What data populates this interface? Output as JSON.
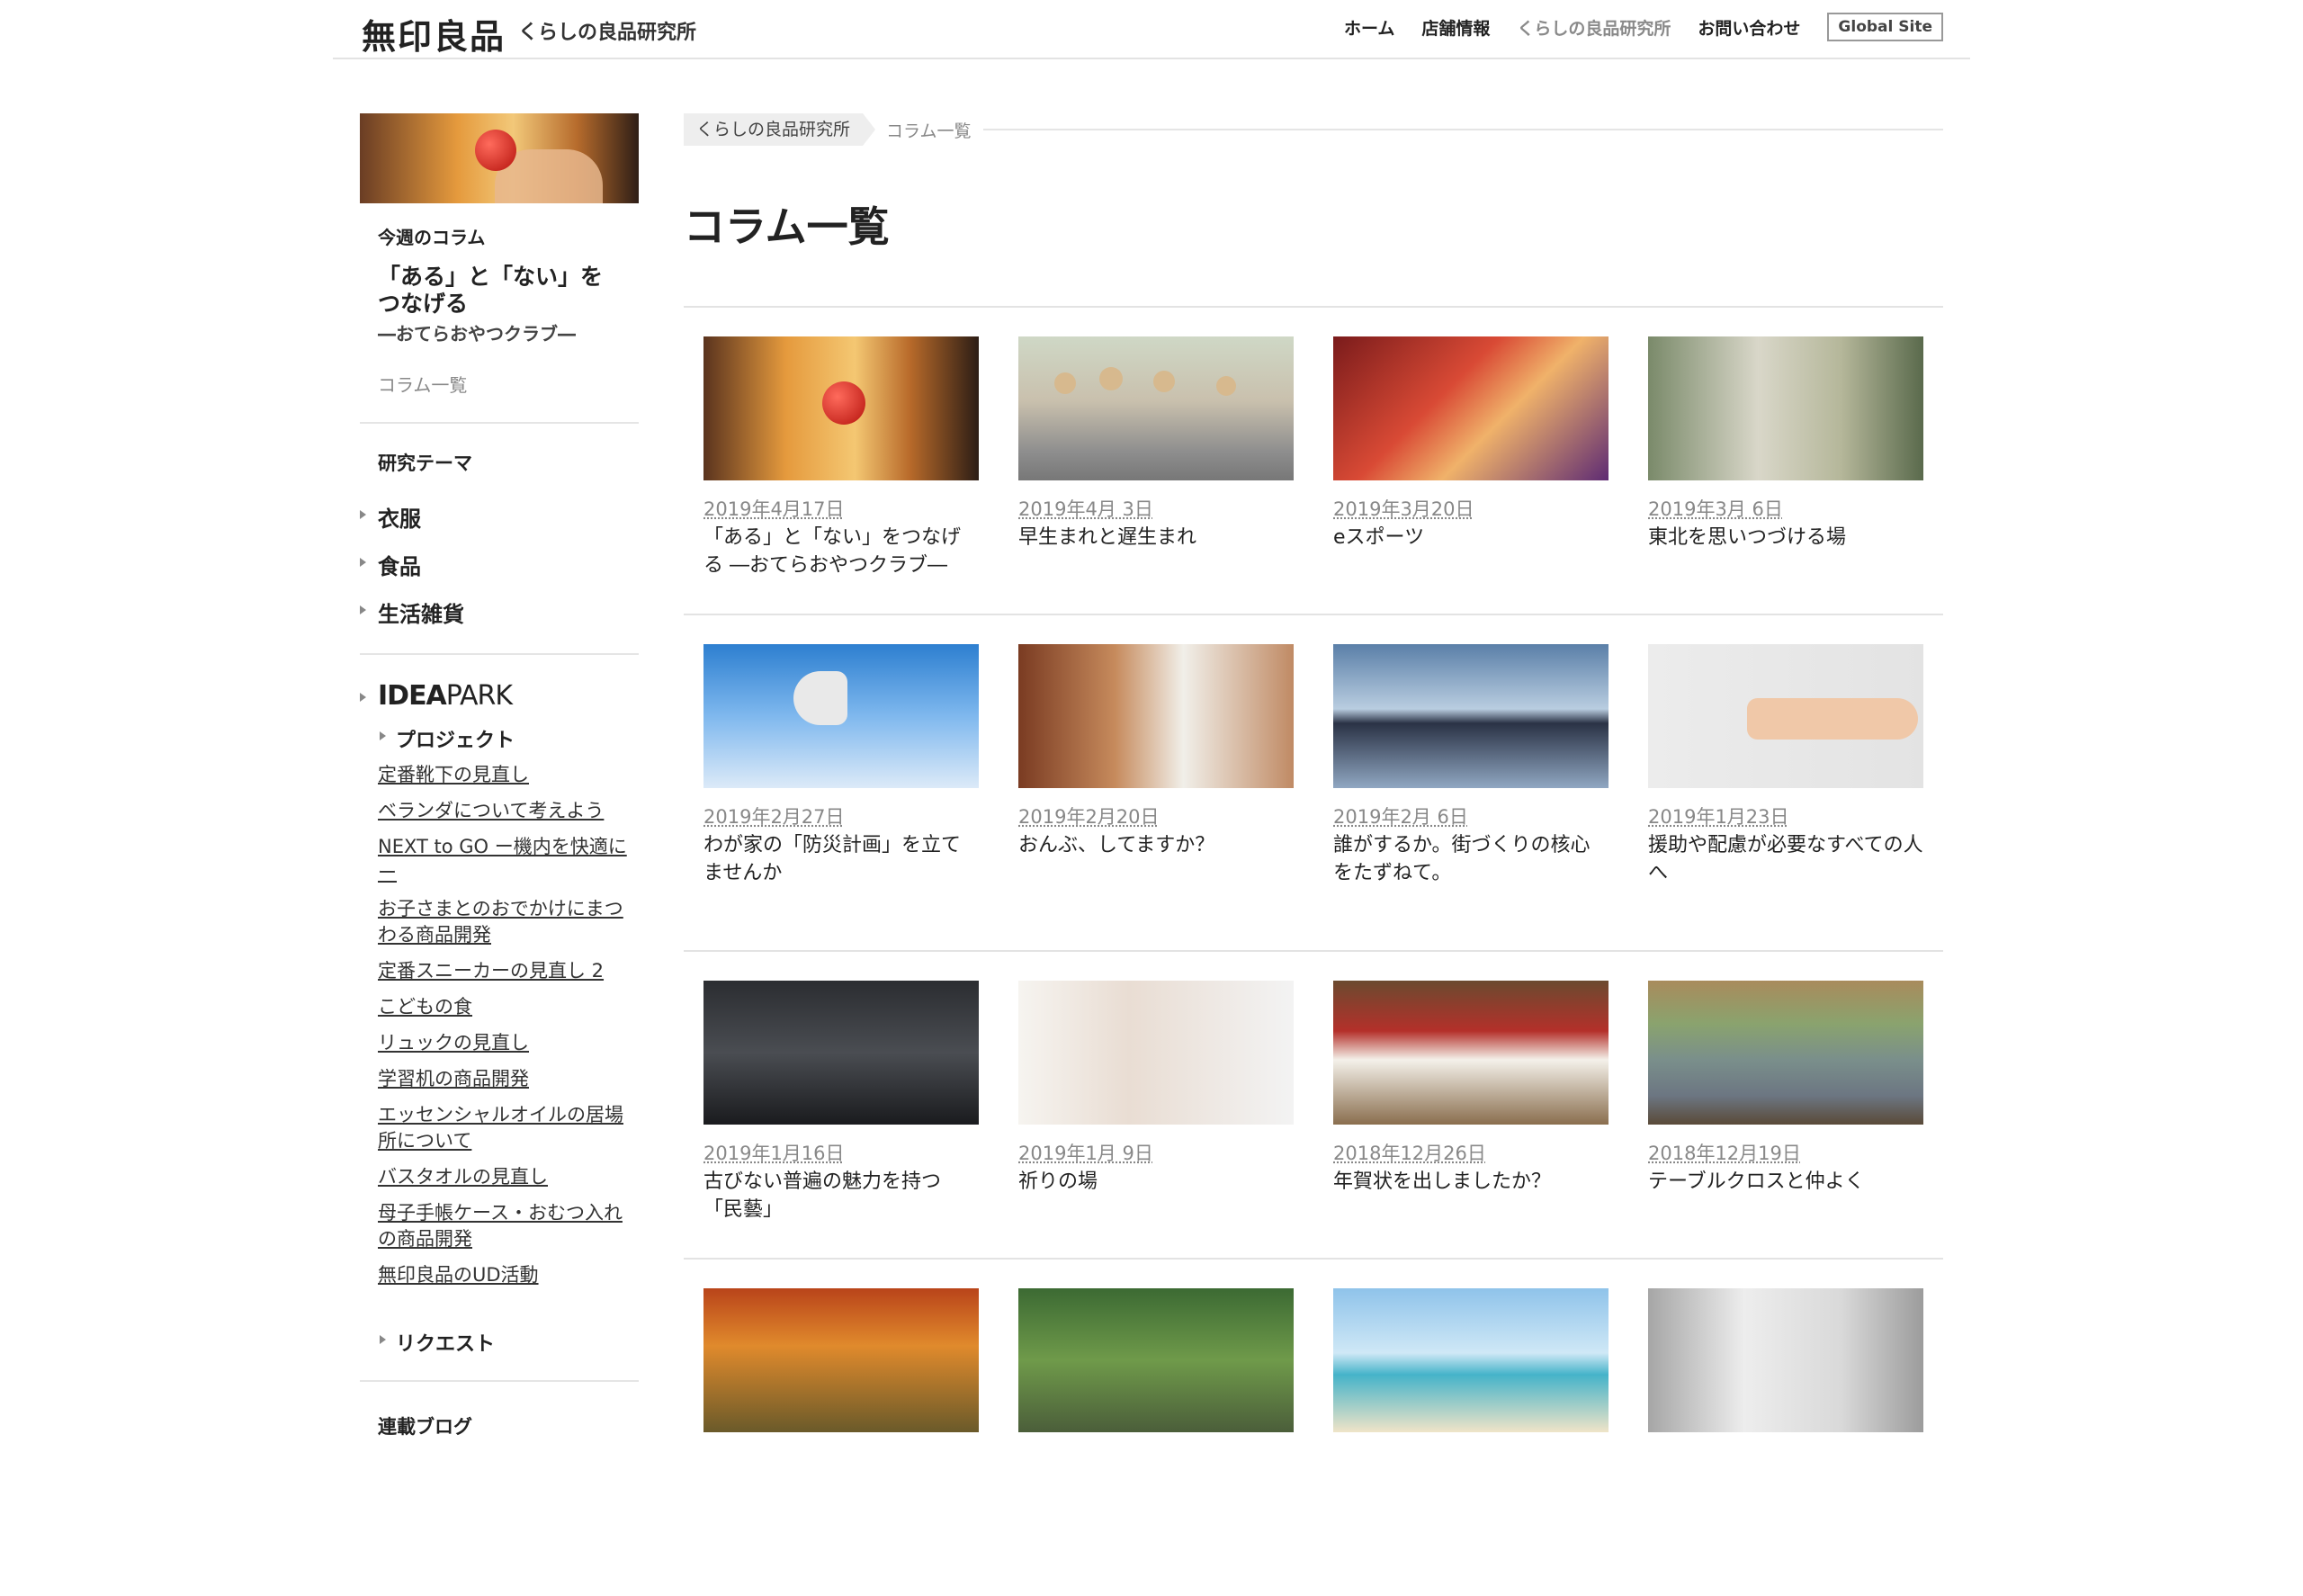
{
  "header": {
    "logo": "無印良品",
    "site_name": "くらしの良品研究所",
    "nav": [
      {
        "label": "ホーム"
      },
      {
        "label": "店舗情報"
      },
      {
        "label": "くらしの良品研究所"
      },
      {
        "label": "お問い合わせ"
      }
    ],
    "global_site": "Global Site"
  },
  "sidebar": {
    "week_label": "今週のコラム",
    "week_title": "「ある」と「ない」をつなげる",
    "week_sub": "―おてらおやつクラブ―",
    "column_list_link": "コラム一覧",
    "theme_title": "研究テーマ",
    "themes": [
      "衣服",
      "食品",
      "生活雑貨"
    ],
    "ideapark_bold": "IDEA",
    "ideapark_rest": "PARK",
    "project_label": "プロジェクト",
    "projects": [
      "定番靴下の見直し",
      "ベランダについて考えよう",
      "NEXT to GO ー機内を快適にー",
      "お子さまとのおでかけにまつわる商品開発",
      "定番スニーカーの見直し 2",
      "こどもの食",
      "リュックの見直し",
      "学習机の商品開発",
      "エッセンシャルオイルの居場所について",
      "バスタオルの見直し",
      "母子手帳ケース・おむつ入れの商品開発",
      "無印良品のUD活動"
    ],
    "request_label": "リクエスト",
    "blog_label": "連載ブログ"
  },
  "main": {
    "breadcrumb_root": "くらしの良品研究所",
    "breadcrumb_current": "コラム一覧",
    "page_title": "コラム一覧",
    "columns": [
      {
        "date": "2019年4月17日",
        "title": "「ある」と「ない」をつなげる ―おてらおやつクラブ―"
      },
      {
        "date": "2019年4月 3日",
        "title": "早生まれと遅生まれ"
      },
      {
        "date": "2019年3月20日",
        "title": "eスポーツ"
      },
      {
        "date": "2019年3月 6日",
        "title": "東北を思いつづける場"
      },
      {
        "date": "2019年2月27日",
        "title": "わが家の「防災計画」を立てませんか"
      },
      {
        "date": "2019年2月20日",
        "title": "おんぶ、してますか？"
      },
      {
        "date": "2019年2月 6日",
        "title": "誰がするか。街づくりの核心をたずねて。"
      },
      {
        "date": "2019年1月23日",
        "title": "援助や配慮が必要なすべての人へ"
      },
      {
        "date": "2019年1月16日",
        "title": "古びない普遍の魅力を持つ「民藝」"
      },
      {
        "date": "2019年1月 9日",
        "title": "祈りの場"
      },
      {
        "date": "2018年12月26日",
        "title": "年賀状を出しましたか？"
      },
      {
        "date": "2018年12月19日",
        "title": "テーブルクロスと仲よく"
      }
    ]
  }
}
